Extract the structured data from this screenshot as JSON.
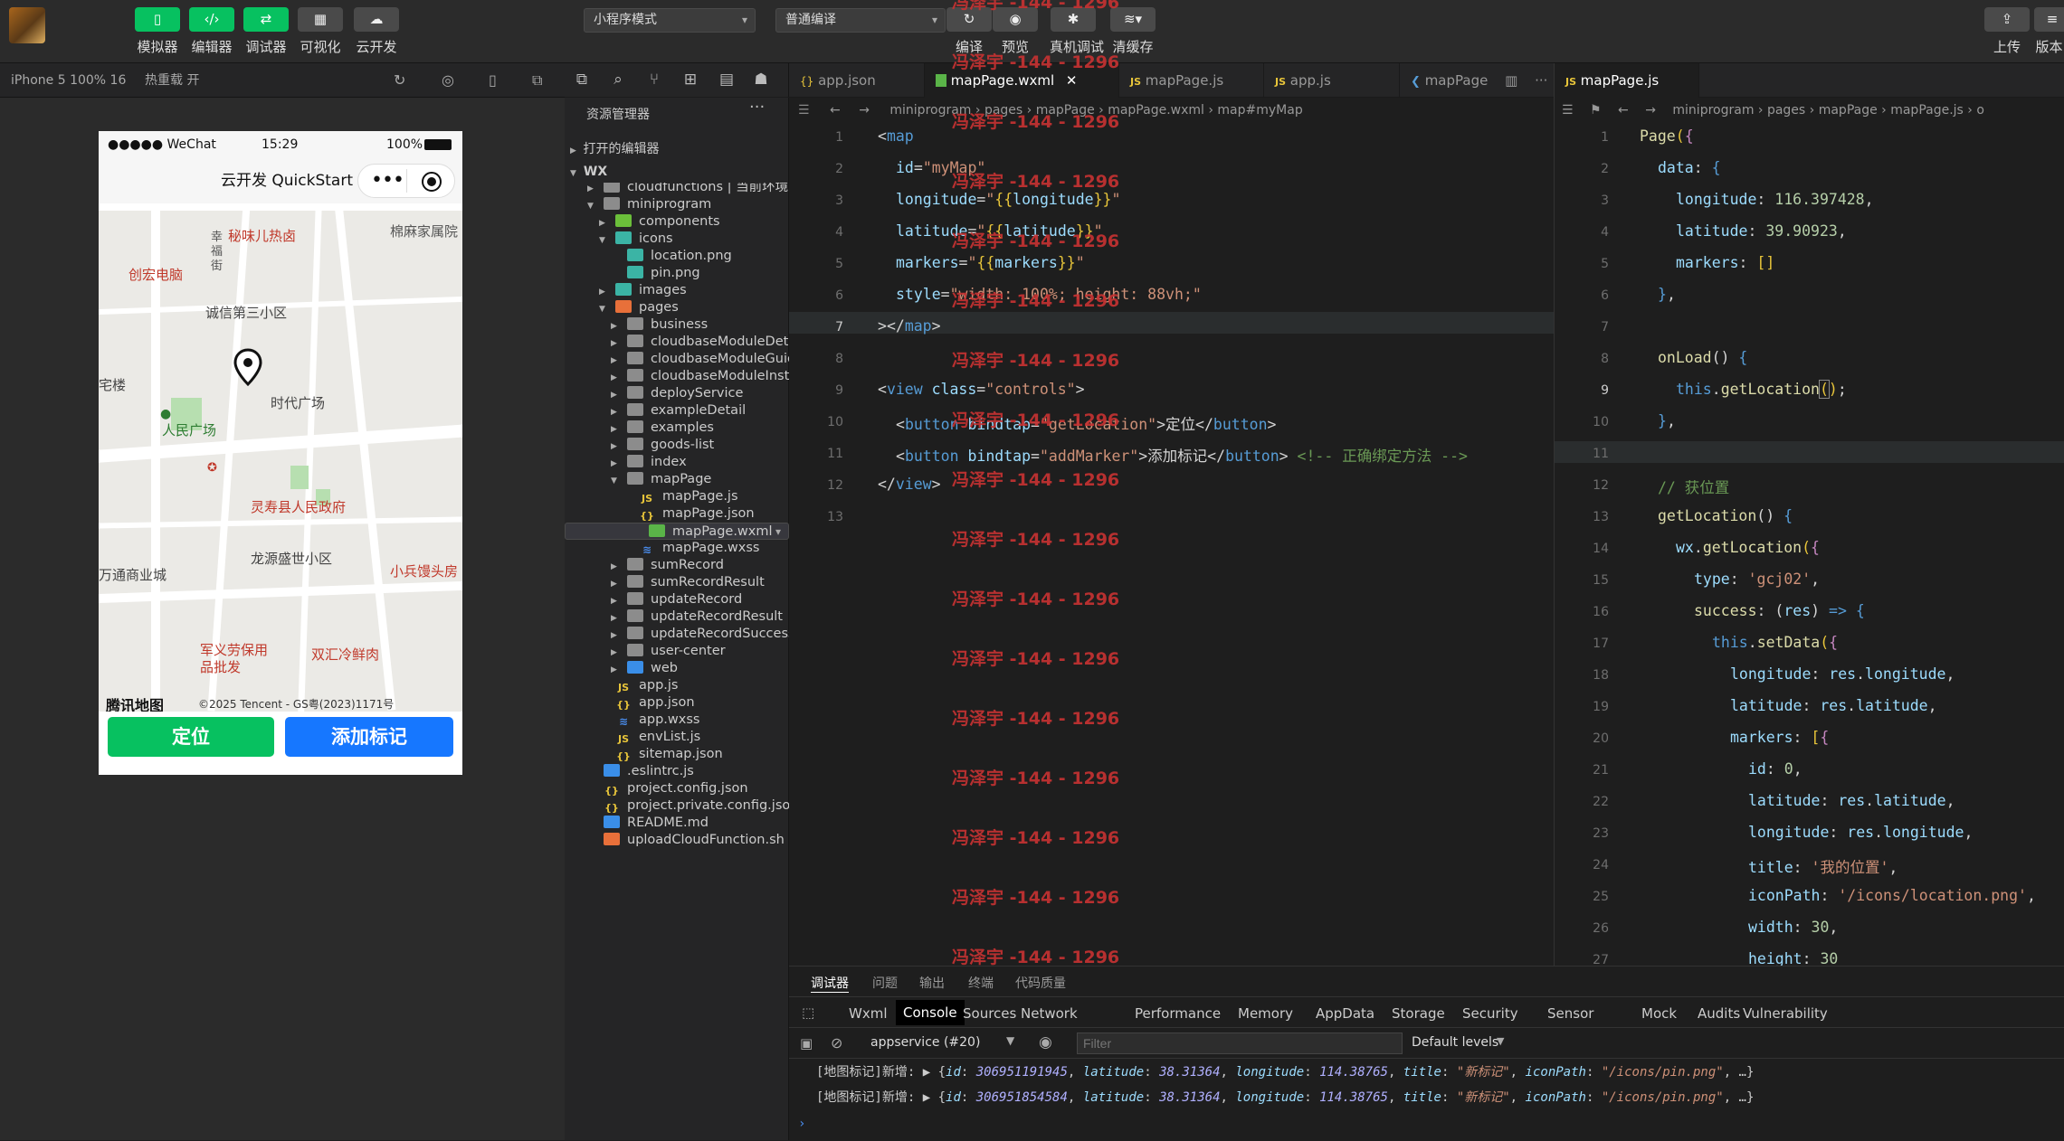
{
  "toolbar": {
    "buttons": [
      {
        "label": "模拟器",
        "icon": "phone-icon"
      },
      {
        "label": "编辑器",
        "icon": "code-icon"
      },
      {
        "label": "调试器",
        "icon": "debug-icon"
      },
      {
        "label": "可视化",
        "icon": "layout-icon"
      },
      {
        "label": "云开发",
        "icon": "cloud-icon"
      }
    ],
    "mode_select": "小程序模式",
    "compile_select": "普通编译",
    "actions": [
      {
        "label": "编译"
      },
      {
        "label": "预览"
      },
      {
        "label": "真机调试"
      },
      {
        "label": "清缓存"
      }
    ],
    "right": [
      {
        "label": "上传"
      },
      {
        "label": "版本"
      }
    ]
  },
  "simulator": {
    "device": "iPhone 5 100% 16",
    "hot_reload": "热重载 开",
    "status_carrier": "●●●●● WeChat",
    "status_time": "15:29",
    "status_battery": "100%",
    "nav_title": "云开发 QuickStart",
    "map_labels": [
      "秘味儿热卤",
      "棉麻家属院",
      "幸福街",
      "创宏电脑",
      "诚信第三小区",
      "宅楼",
      "时代广场",
      "人民广场",
      "灵寿县人民政府",
      "龙源盛世小区",
      "万通商业城",
      "小兵馒头房",
      "军义劳保用品批发",
      "双汇冷鲜肉",
      "腾讯地图",
      "©2025 Tencent - GS粤(2023)1171号"
    ],
    "btn_locate": "定位",
    "btn_add": "添加标记"
  },
  "explorer": {
    "title": "资源管理器",
    "open_editors": "打开的编辑器",
    "root": "WX",
    "items": [
      {
        "label": "cloudfunctions | 当前环境",
        "depth": 1,
        "type": "folder"
      },
      {
        "label": "miniprogram",
        "depth": 1,
        "type": "folder",
        "open": true
      },
      {
        "label": "components",
        "depth": 2,
        "type": "folder-green"
      },
      {
        "label": "icons",
        "depth": 2,
        "type": "folder-teal",
        "open": true
      },
      {
        "label": "location.png",
        "depth": 3,
        "type": "png"
      },
      {
        "label": "pin.png",
        "depth": 3,
        "type": "png"
      },
      {
        "label": "images",
        "depth": 2,
        "type": "folder-teal"
      },
      {
        "label": "pages",
        "depth": 2,
        "type": "folder-orange",
        "open": true
      },
      {
        "label": "business",
        "depth": 3,
        "type": "folder"
      },
      {
        "label": "cloudbaseModuleDetail",
        "depth": 3,
        "type": "folder"
      },
      {
        "label": "cloudbaseModuleGuide",
        "depth": 3,
        "type": "folder"
      },
      {
        "label": "cloudbaseModuleInst...",
        "depth": 3,
        "type": "folder"
      },
      {
        "label": "deployService",
        "depth": 3,
        "type": "folder"
      },
      {
        "label": "exampleDetail",
        "depth": 3,
        "type": "folder"
      },
      {
        "label": "examples",
        "depth": 3,
        "type": "folder"
      },
      {
        "label": "goods-list",
        "depth": 3,
        "type": "folder"
      },
      {
        "label": "index",
        "depth": 3,
        "type": "folder"
      },
      {
        "label": "mapPage",
        "depth": 3,
        "type": "folder",
        "open": true
      },
      {
        "label": "mapPage.js",
        "depth": 4,
        "type": "js"
      },
      {
        "label": "mapPage.json",
        "depth": 4,
        "type": "json"
      },
      {
        "label": "mapPage.wxml",
        "depth": 4,
        "type": "wxml",
        "selected": true
      },
      {
        "label": "mapPage.wxss",
        "depth": 4,
        "type": "wxss"
      },
      {
        "label": "sumRecord",
        "depth": 3,
        "type": "folder"
      },
      {
        "label": "sumRecordResult",
        "depth": 3,
        "type": "folder"
      },
      {
        "label": "updateRecord",
        "depth": 3,
        "type": "folder"
      },
      {
        "label": "updateRecordResult",
        "depth": 3,
        "type": "folder"
      },
      {
        "label": "updateRecordSuccess",
        "depth": 3,
        "type": "folder"
      },
      {
        "label": "user-center",
        "depth": 3,
        "type": "folder"
      },
      {
        "label": "web",
        "depth": 3,
        "type": "folder-blue"
      },
      {
        "label": "app.js",
        "depth": 2,
        "type": "js"
      },
      {
        "label": "app.json",
        "depth": 2,
        "type": "json"
      },
      {
        "label": "app.wxss",
        "depth": 2,
        "type": "wxss"
      },
      {
        "label": "envList.js",
        "depth": 2,
        "type": "js"
      },
      {
        "label": "sitemap.json",
        "depth": 2,
        "type": "json"
      },
      {
        "label": ".eslintrc.js",
        "depth": 1,
        "type": "eslint"
      },
      {
        "label": "project.config.json",
        "depth": 1,
        "type": "json"
      },
      {
        "label": "project.private.config.json",
        "depth": 1,
        "type": "json"
      },
      {
        "label": "README.md",
        "depth": 1,
        "type": "info"
      },
      {
        "label": "uploadCloudFunction.sh",
        "depth": 1,
        "type": "sh"
      }
    ]
  },
  "editor1": {
    "tabs": [
      {
        "label": "app.json",
        "icon": "{}"
      },
      {
        "label": "mapPage.wxml",
        "icon": "wxml",
        "active": true
      },
      {
        "label": "mapPage.js",
        "icon": "JS"
      },
      {
        "label": "app.js",
        "icon": "JS"
      },
      {
        "label": "mapPage",
        "icon": "css"
      }
    ],
    "breadcrumb": "miniprogram › pages › mapPage › mapPage.wxml › map#myMap",
    "lines": [
      "1",
      "2",
      "3",
      "4",
      "5",
      "6",
      "7",
      "8",
      "9",
      "10",
      "11",
      "12",
      "13"
    ]
  },
  "editor2": {
    "tabs": [
      {
        "label": "mapPage.js",
        "icon": "JS",
        "active": true
      }
    ],
    "breadcrumb": "miniprogram › pages › mapPage › mapPage.js › o",
    "lines": [
      "1",
      "2",
      "3",
      "4",
      "5",
      "6",
      "7",
      "8",
      "9",
      "10",
      "11",
      "12",
      "13",
      "14",
      "15",
      "16",
      "17",
      "18",
      "19",
      "20",
      "21",
      "22",
      "23",
      "24",
      "25",
      "26",
      "27"
    ]
  },
  "watermark": "冯泽宇 -144 - 1296",
  "panel": {
    "tabs": [
      "调试器",
      "问题",
      "输出",
      "终端",
      "代码质量"
    ],
    "devtools_tabs": [
      "Wxml",
      "Console",
      "Sources",
      "Network",
      "Performance",
      "Memory",
      "AppData",
      "Storage",
      "Security",
      "Sensor",
      "Mock",
      "Audits",
      "Vulnerability"
    ],
    "context": "appservice (#20)",
    "filter_placeholder": "Filter",
    "levels": "Default levels",
    "logs": [
      {
        "prefix": "[地图标记]新增:",
        "id": "306951191945",
        "lat": "38.31364",
        "lng": "114.38765",
        "title": "\"新标记\"",
        "icon": "\"/icons/pin.png\""
      },
      {
        "prefix": "[地图标记]新增:",
        "id": "306951854584",
        "lat": "38.31364",
        "lng": "114.38765",
        "title": "\"新标记\"",
        "icon": "\"/icons/pin.png\""
      }
    ]
  }
}
